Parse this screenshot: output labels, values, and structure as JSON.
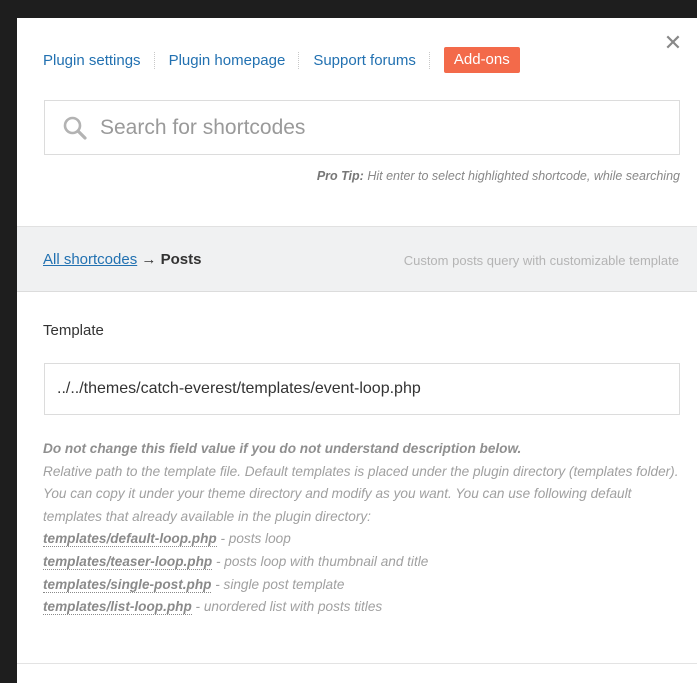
{
  "nav": {
    "plugin_settings": "Plugin settings",
    "plugin_homepage": "Plugin homepage",
    "support_forums": "Support forums",
    "addons": "Add-ons"
  },
  "close_glyph": "✕",
  "search": {
    "placeholder": "Search for shortcodes",
    "value": ""
  },
  "protip": {
    "label": "Pro Tip:",
    "text": "Hit enter to select highlighted shortcode, while searching"
  },
  "breadcrumb": {
    "link": "All shortcodes",
    "arrow": "→",
    "current": "Posts",
    "description": "Custom posts query with customizable template"
  },
  "template_field": {
    "label": "Template",
    "value": "../../themes/catch-everest/templates/event-loop.php"
  },
  "description": {
    "warning": "Do not change this field value if you do not understand description below.",
    "line1": "Relative path to the template file. Default templates is placed under the plugin directory (templates folder). You can copy it under your theme directory and modify as you want. You can use following default templates that already available in the plugin directory:",
    "templates": [
      {
        "file": "templates/default-loop.php",
        "note": " - posts loop"
      },
      {
        "file": "templates/teaser-loop.php",
        "note": " - posts loop with thumbnail and title"
      },
      {
        "file": "templates/single-post.php",
        "note": " - single post template"
      },
      {
        "file": "templates/list-loop.php",
        "note": " - unordered list with posts titles"
      }
    ]
  },
  "colors": {
    "link": "#2271b1",
    "addons_button": "#f36a4a",
    "backdrop": "#1e1e1e",
    "breadcrumb_bg": "#f0f1f2"
  },
  "icons": {
    "search": "search-icon",
    "close": "close-icon"
  }
}
